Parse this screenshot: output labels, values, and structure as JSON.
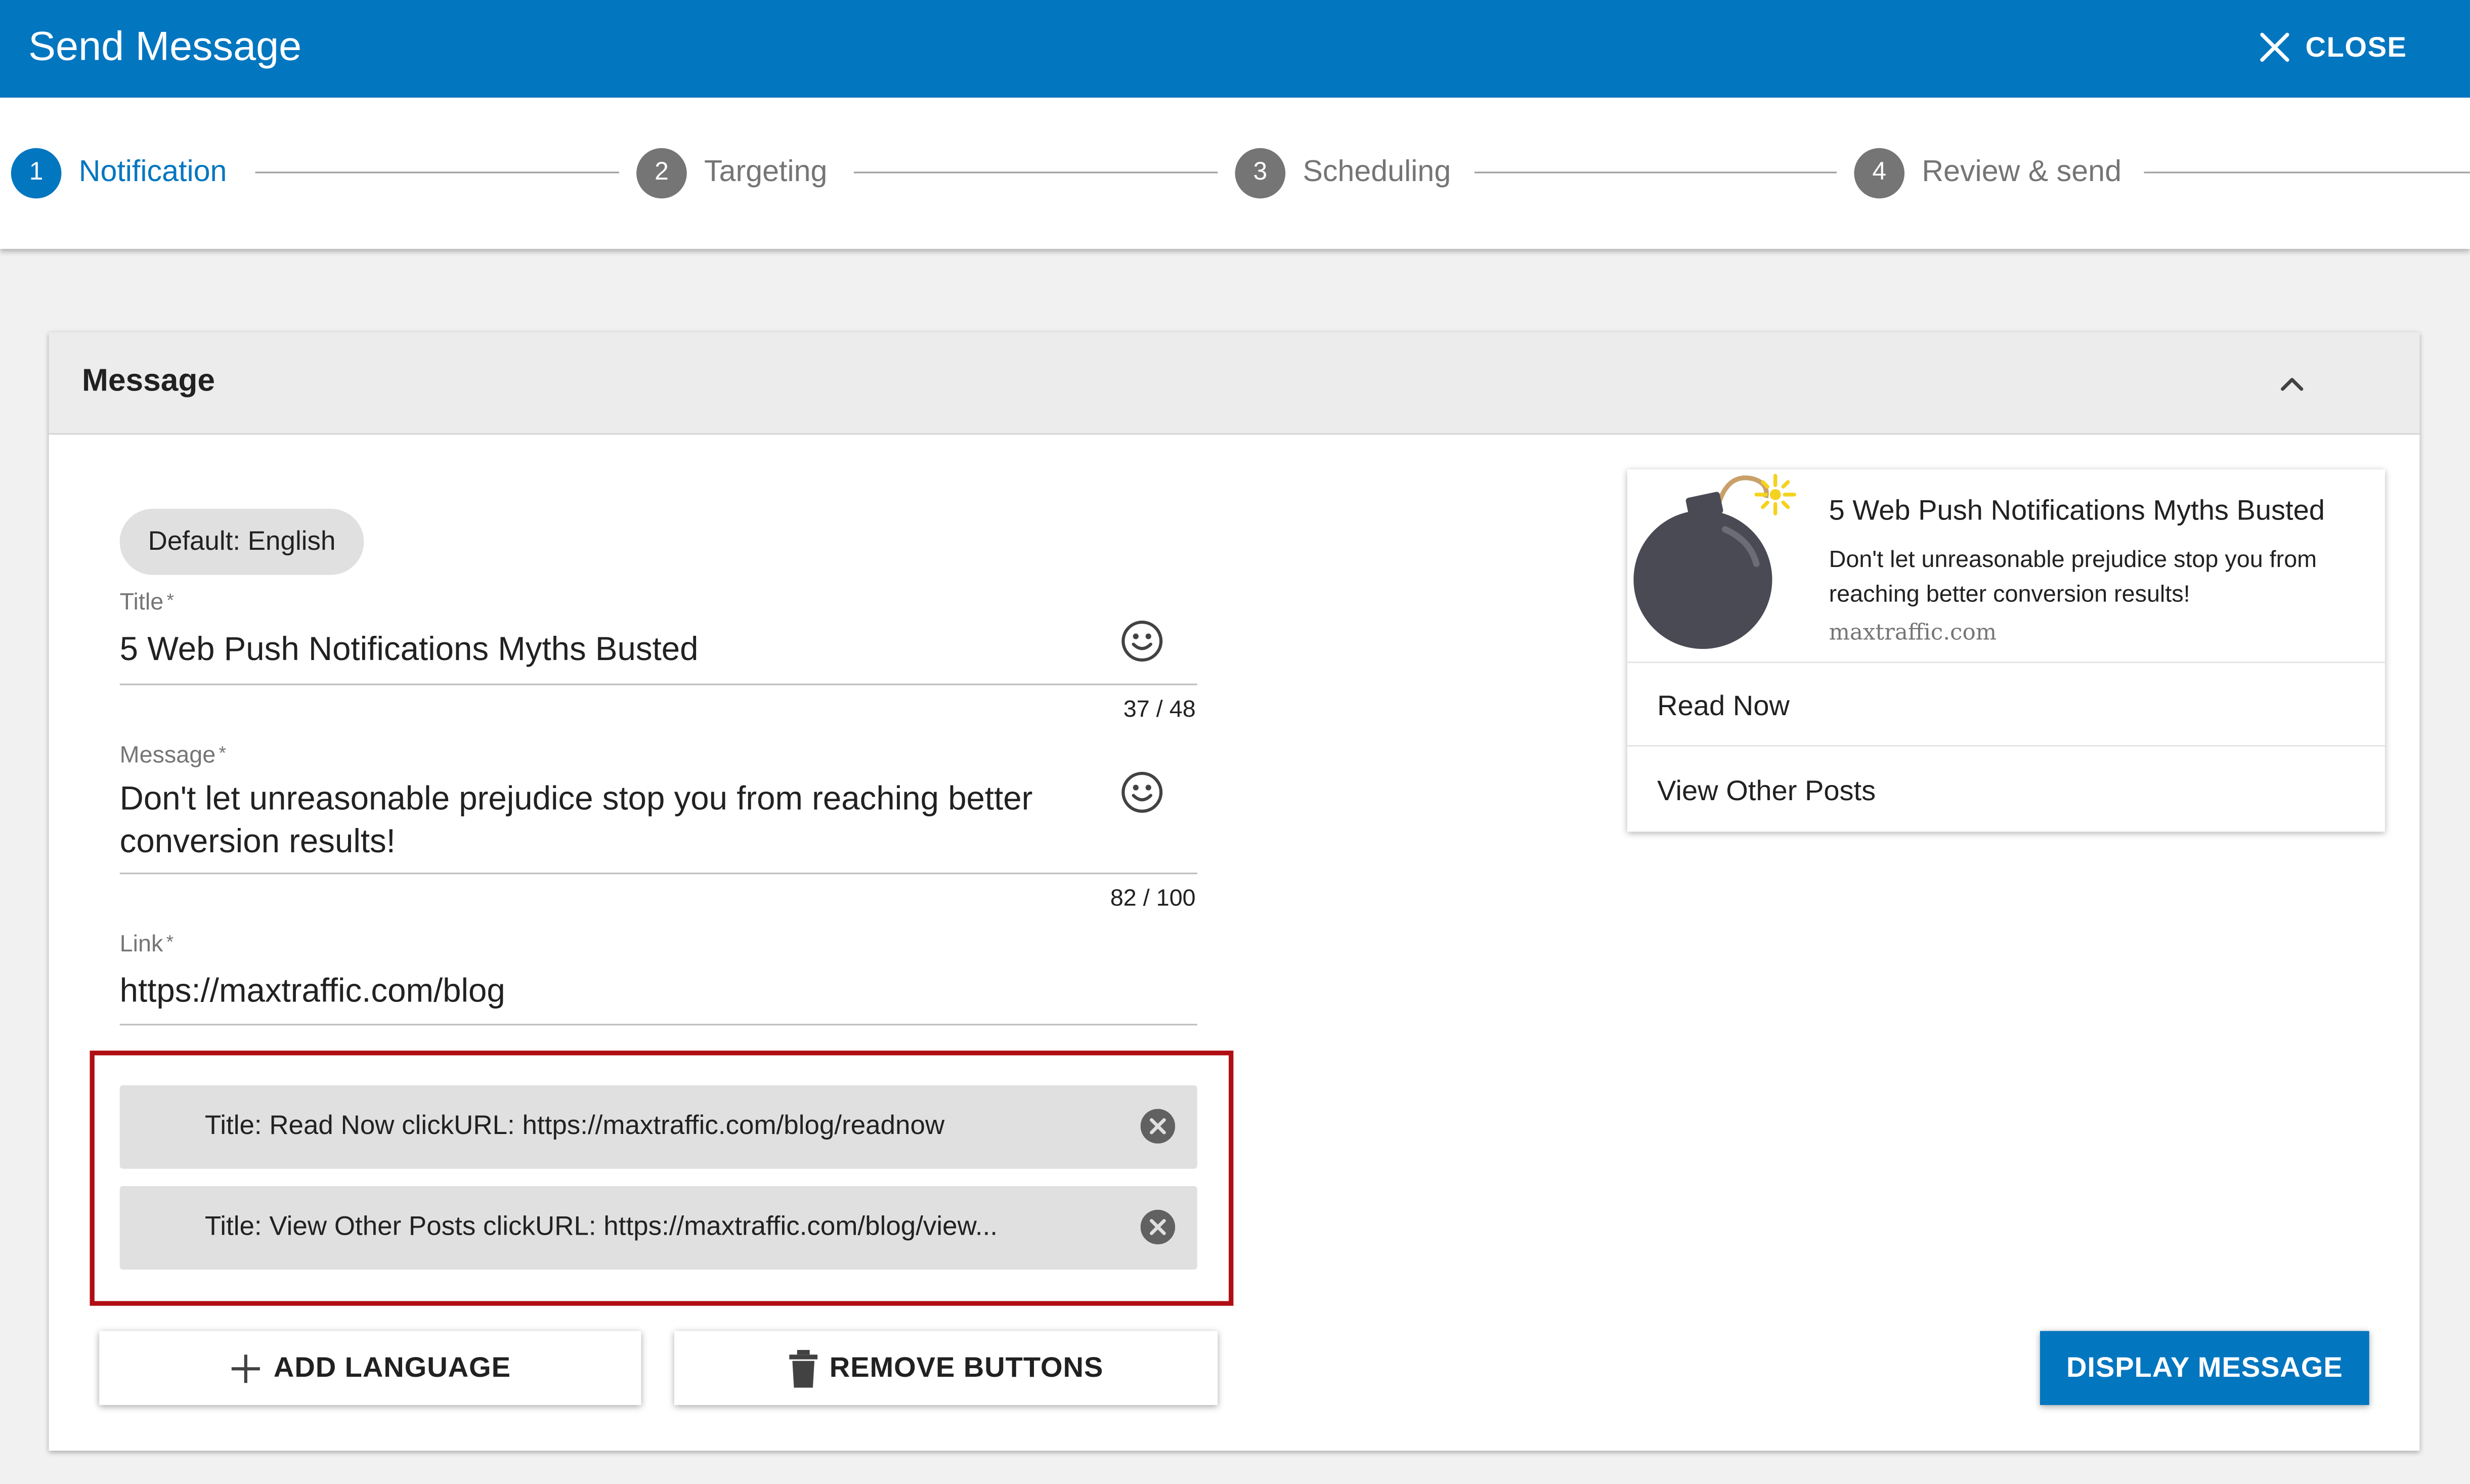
{
  "header": {
    "title": "Send Message",
    "close_label": "CLOSE"
  },
  "steps": [
    {
      "num": "1",
      "label": "Notification",
      "active": true
    },
    {
      "num": "2",
      "label": "Targeting",
      "active": false
    },
    {
      "num": "3",
      "label": "Scheduling",
      "active": false
    },
    {
      "num": "4",
      "label": "Review & send",
      "active": false
    }
  ],
  "card": {
    "title": "Message"
  },
  "language_chip": "Default: English",
  "form": {
    "title": {
      "label": "Title",
      "required": "*",
      "value": "5 Web Push Notifications Myths Busted",
      "counter": "37 / 48"
    },
    "message": {
      "label": "Message",
      "required": "*",
      "value_line1": "Don't let unreasonable prejudice stop you from reaching better",
      "value_line2": "conversion results!",
      "counter": "82 / 100"
    },
    "link": {
      "label": "Link",
      "required": "*",
      "value": "https://maxtraffic.com/blog"
    }
  },
  "action_buttons": [
    {
      "text": "Title: Read Now clickURL: https://maxtraffic.com/blog/readnow"
    },
    {
      "text": "Title: View Other Posts clickURL: https://maxtraffic.com/blog/view..."
    }
  ],
  "buttons": {
    "add_language": "ADD LANGUAGE",
    "remove_buttons": "REMOVE BUTTONS",
    "display_message": "DISPLAY MESSAGE"
  },
  "preview": {
    "title": "5 Web Push Notifications Myths Busted",
    "message_line1": "Don't let unreasonable prejudice stop you from",
    "message_line2": "reaching better conversion results!",
    "domain": "maxtraffic.com",
    "actions": [
      "Read Now",
      "View Other Posts"
    ]
  },
  "icons": {
    "close": "close-icon",
    "collapse": "chevron-up-icon",
    "emoji": "smiley-icon",
    "remove_chip": "cancel-circle-icon",
    "add": "plus-icon",
    "trash": "trash-icon",
    "bomb": "bomb-image"
  },
  "colors": {
    "primary": "#0376c0",
    "highlight": "#b00e14",
    "chip": "#e0e0e0"
  }
}
